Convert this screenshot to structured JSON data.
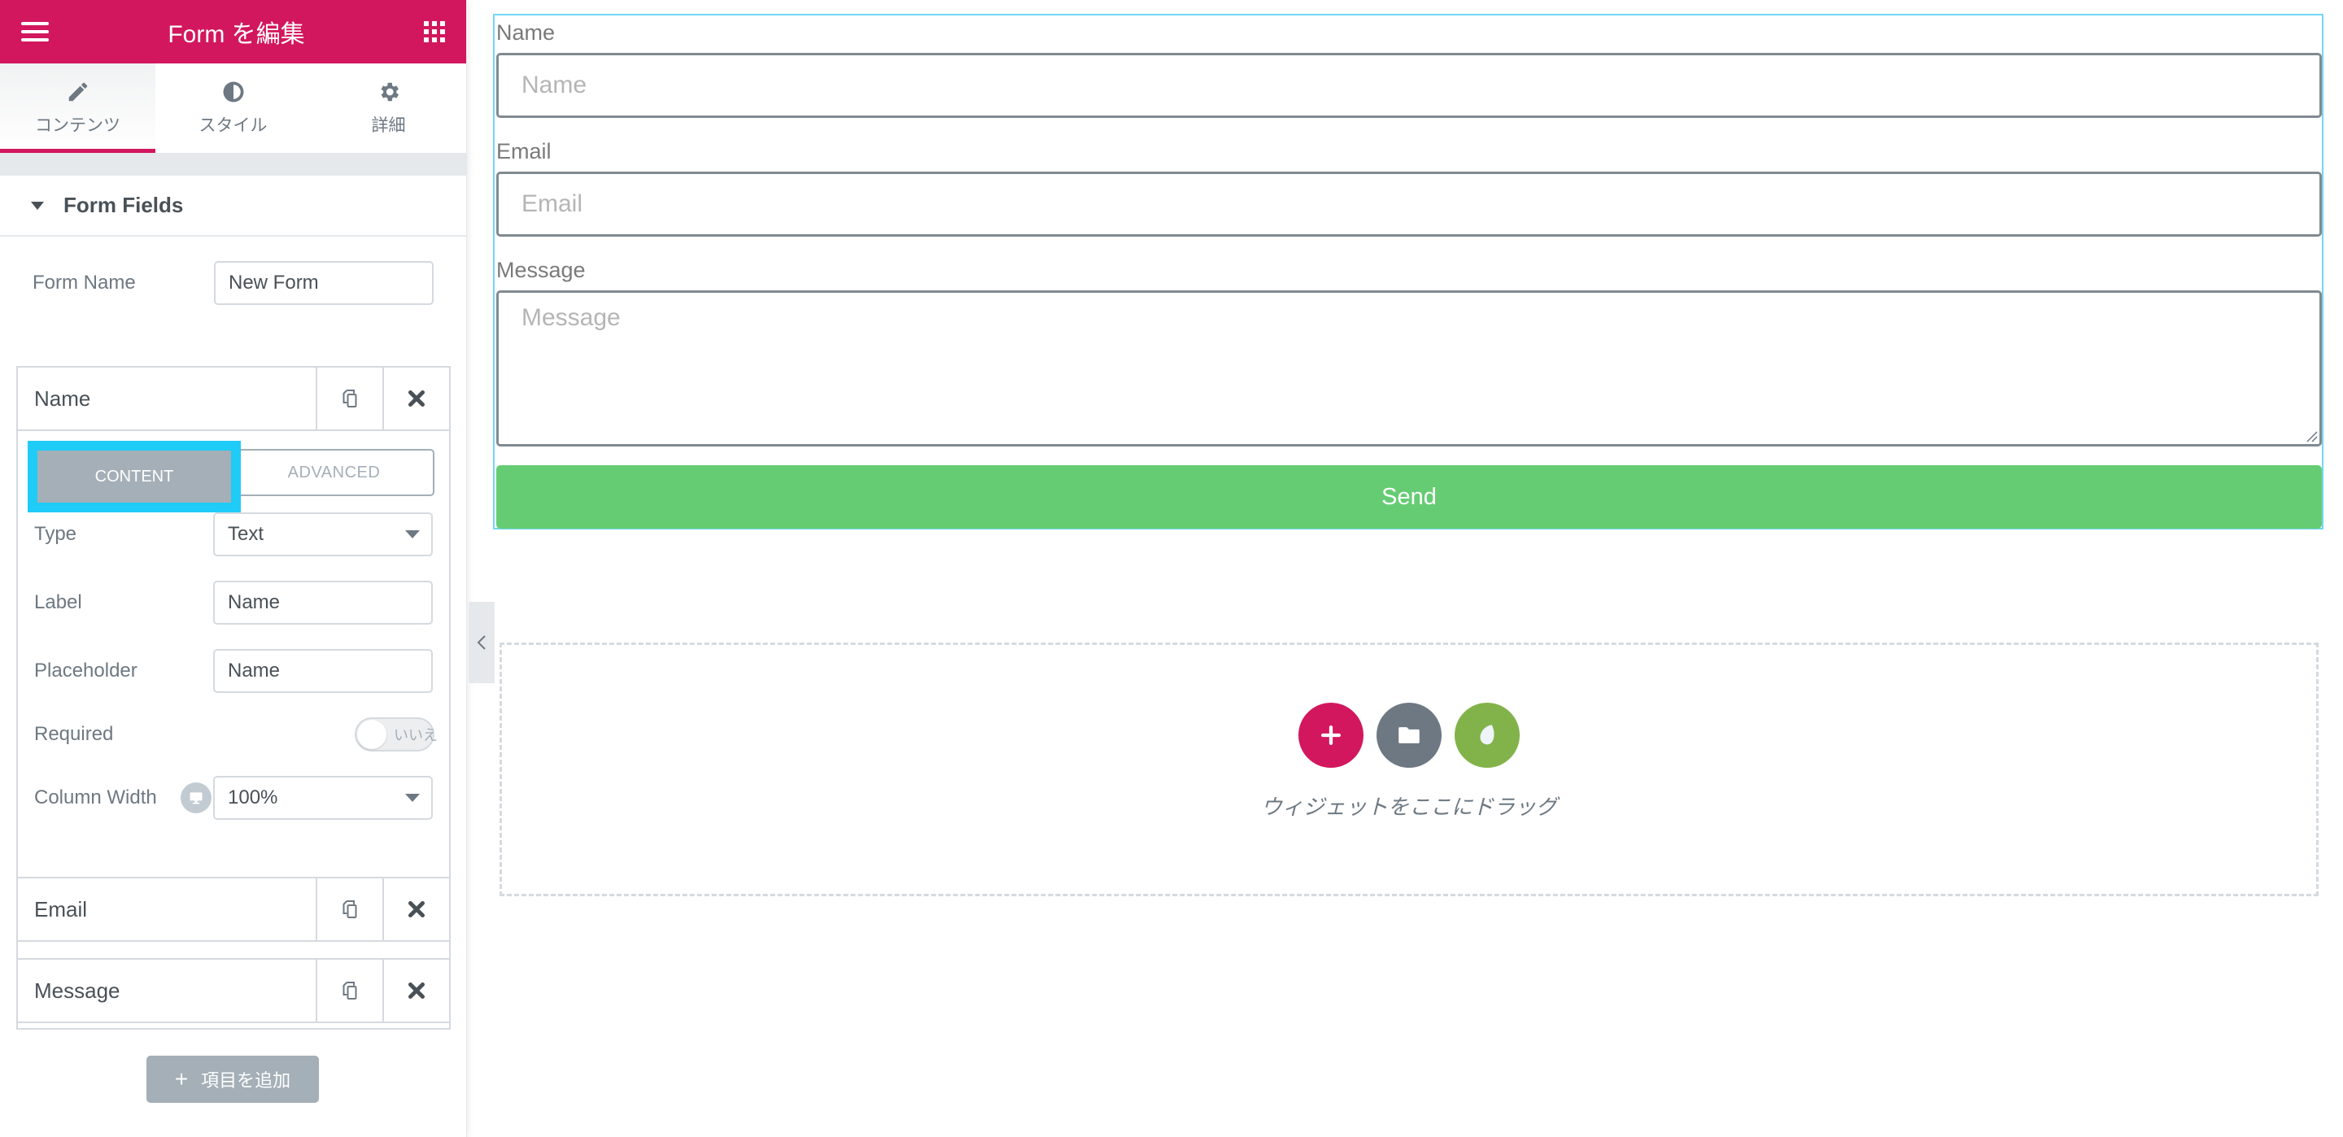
{
  "panel": {
    "title": "Form を編集",
    "tabs": [
      {
        "label": "コンテンツ",
        "icon": "pencil-icon",
        "active": true
      },
      {
        "label": "スタイル",
        "icon": "contrast-icon",
        "active": false
      },
      {
        "label": "詳細",
        "icon": "gear-icon",
        "active": false
      }
    ],
    "section_title": "Form Fields",
    "form_name_label": "Form Name",
    "form_name_value": "New Form",
    "fields": [
      {
        "title": "Name",
        "expanded": true,
        "inner_tabs": {
          "content": "CONTENT",
          "advanced": "ADVANCED",
          "active": "content"
        },
        "type_label": "Type",
        "type_value": "Text",
        "label_label": "Label",
        "label_value": "Name",
        "placeholder_label": "Placeholder",
        "placeholder_value": "Name",
        "required_label": "Required",
        "required_toggle_text": "いいえ",
        "required_value": false,
        "column_width_label": "Column Width",
        "column_width_value": "100%"
      },
      {
        "title": "Email",
        "expanded": false
      },
      {
        "title": "Message",
        "expanded": false
      }
    ],
    "add_item_label": "項目を追加"
  },
  "canvas": {
    "form": {
      "fields": [
        {
          "label": "Name",
          "placeholder": "Name"
        },
        {
          "label": "Email",
          "placeholder": "Email"
        },
        {
          "label": "Message",
          "placeholder": "Message"
        }
      ],
      "submit_label": "Send"
    },
    "dropzone_text": "ウィジェットをここにドラッグ"
  },
  "colors": {
    "brand": "#d2175e",
    "submit": "#66cc74",
    "highlight": "#1fcbf7",
    "template_library": "#6d7882",
    "envato": "#82b34a"
  }
}
